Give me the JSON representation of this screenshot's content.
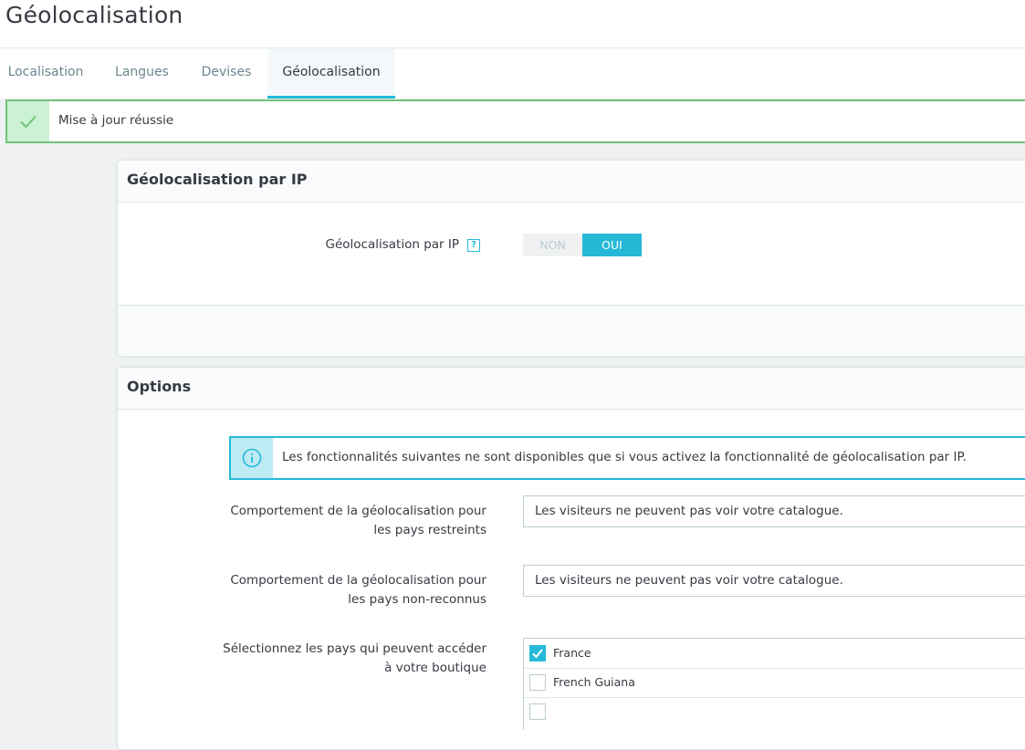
{
  "page": {
    "title": "Géolocalisation"
  },
  "tabs": [
    {
      "label": "Localisation"
    },
    {
      "label": "Langues"
    },
    {
      "label": "Devises"
    },
    {
      "label": "Géolocalisation",
      "active": true
    }
  ],
  "alert": {
    "message": "Mise à jour réussie",
    "icon": "check-icon"
  },
  "ip_panel": {
    "title": "Géolocalisation par IP",
    "field_label": "Géolocalisation par IP",
    "help_glyph": "?",
    "switch": {
      "off_label": "NON",
      "on_label": "OUI",
      "value": "OUI"
    }
  },
  "options_panel": {
    "title": "Options",
    "info_message": "Les fonctionnalités suivantes ne sont disponibles que si vous activez la fonctionnalité de géolocalisation par IP.",
    "restricted": {
      "label_line1": "Comportement de la géolocalisation pour",
      "label_line2": "les pays restreints",
      "value": "Les visiteurs ne peuvent pas voir votre catalogue."
    },
    "unrecognized": {
      "label_line1": "Comportement de la géolocalisation pour",
      "label_line2": "les pays non-reconnus",
      "value": "Les visiteurs ne peuvent pas voir votre catalogue."
    },
    "countries": {
      "label_line1": "Sélectionnez les pays qui peuvent accéder",
      "label_line2": "à votre boutique",
      "items": [
        {
          "name": "France",
          "checked": true
        },
        {
          "name": "French Guiana",
          "checked": false
        }
      ]
    }
  },
  "colors": {
    "accent": "#25b9d7",
    "success": "#72c279",
    "text": "#363a41"
  }
}
